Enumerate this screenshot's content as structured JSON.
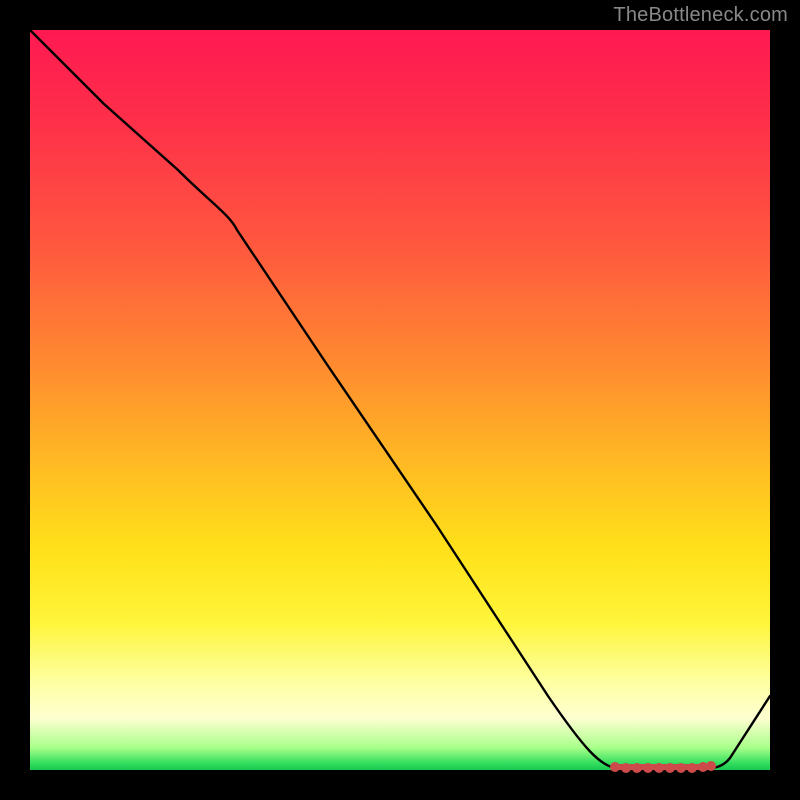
{
  "attribution": "TheBottleneck.com",
  "chart_data": {
    "type": "line",
    "title": "",
    "xlabel": "",
    "ylabel": "",
    "xlim": [
      0,
      100
    ],
    "ylim": [
      0,
      100
    ],
    "background_gradient": {
      "top": "#fe1951",
      "bottom": "#18c850",
      "stops": [
        "#fe1951",
        "#ff5a3e",
        "#ffb824",
        "#fff53a",
        "#feffd0",
        "#38e060"
      ]
    },
    "series": [
      {
        "name": "bottleneck-curve",
        "x": [
          0,
          10,
          20,
          28,
          40,
          55,
          70,
          78,
          82,
          86,
          90,
          94,
          100
        ],
        "y": [
          100,
          90,
          81,
          74,
          55,
          33,
          10,
          0,
          0,
          0,
          0,
          0,
          10
        ]
      }
    ],
    "markers": {
      "name": "highlighted-range",
      "x": [
        79,
        80.5,
        82,
        83.5,
        85,
        86.5,
        88,
        89.5,
        91,
        92
      ],
      "y": [
        0,
        0,
        0,
        0,
        0,
        0,
        0,
        0,
        0,
        0
      ],
      "color": "#cc4a4a"
    }
  }
}
